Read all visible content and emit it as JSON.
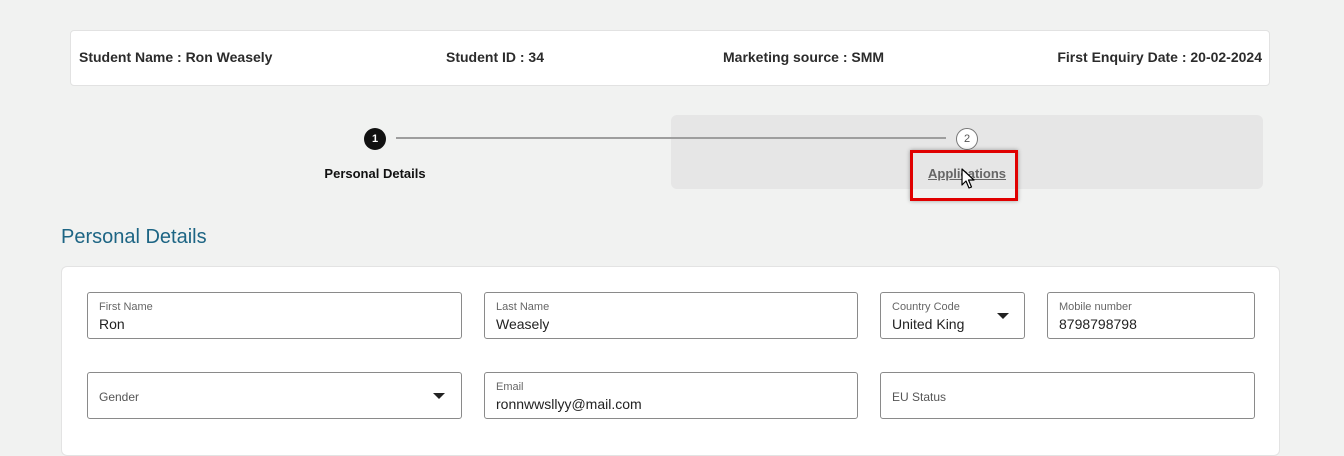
{
  "header": {
    "student_name": "Student Name : Ron Weasely",
    "student_id": "Student ID : 34",
    "marketing_source": "Marketing source : SMM",
    "first_enquiry_date": "First Enquiry Date : 20-02-2024"
  },
  "stepper": {
    "steps": [
      {
        "number": "1",
        "label": "Personal Details",
        "state": "active"
      },
      {
        "number": "2",
        "label": "Applications",
        "state": "inactive"
      }
    ]
  },
  "section": {
    "title": "Personal Details"
  },
  "form": {
    "first_name": {
      "label": "First Name",
      "value": "Ron"
    },
    "last_name": {
      "label": "Last Name",
      "value": "Weasely"
    },
    "country_code": {
      "label": "Country Code",
      "value": "United King"
    },
    "mobile": {
      "label": "Mobile number",
      "value": "8798798798"
    },
    "gender": {
      "label": "Gender",
      "value": ""
    },
    "email": {
      "label": "Email",
      "value": "ronnwwsllyy@mail.com"
    },
    "eu_status": {
      "label": "EU Status",
      "value": ""
    }
  },
  "colors": {
    "accent": "#1d6584",
    "highlight": "#e00000",
    "active_step": "#111111"
  },
  "icons": {
    "dropdown": "caret-down-icon",
    "cursor": "mouse-pointer-icon"
  }
}
